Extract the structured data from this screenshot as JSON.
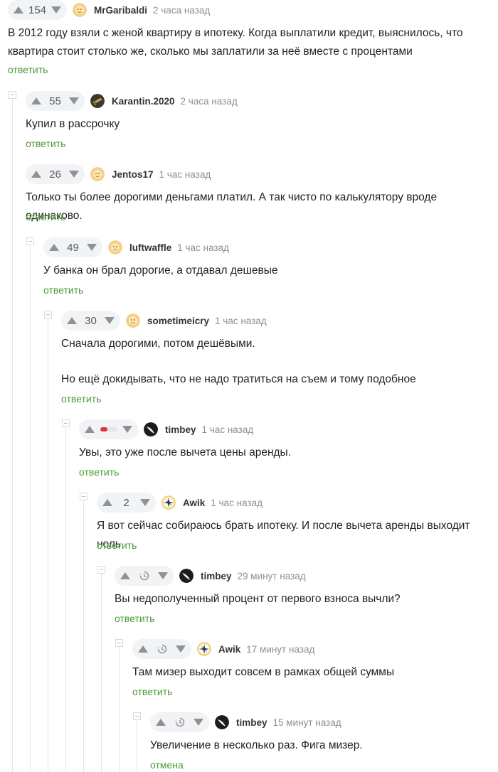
{
  "ui": {
    "reply_label": "ответить",
    "cancel_label": "отмена",
    "colors": {
      "accent_green": "#4a9b32",
      "minus_red": "#e0323a"
    }
  },
  "comments": [
    {
      "rating": "154",
      "author": "MrGaribaldi",
      "time": "2 часа назад",
      "text": "В 2012 году взяли с женой квартиру в ипотеку. Когда выплатили кредит, выяснилось, что квартира стоит столько же, сколько мы заплатили за неё вместе с процентами",
      "avatar": "default-avatar-icon"
    },
    {
      "rating": "55",
      "author": "Karantin.2020",
      "time": "2 часа назад",
      "text": "Купил в рассрочку",
      "avatar": "gun-avatar-icon"
    },
    {
      "rating": "26",
      "author": "Jentos17",
      "time": "1 час назад",
      "text": "Только ты более дорогими деньгами платил. А так чисто по калькулятору вроде одинаково.",
      "avatar": "default-avatar-icon"
    },
    {
      "rating": "49",
      "author": "luftwaffle",
      "time": "1 час назад",
      "text": "У банка он брал дорогие, а отдавал дешевые",
      "avatar": "default-avatar-icon"
    },
    {
      "rating": "30",
      "author": "sometimeicry",
      "time": "1 час назад",
      "text": "Сначала дорогими, потом дешёвыми.",
      "text2": "Но ещё докидывать, что не надо тратиться на съем и тому подобное",
      "avatar": "default-avatar-icon"
    },
    {
      "rating_state": "minus",
      "minus_fraction": 0.45,
      "author": "timbey",
      "time": "1 час назад",
      "text": "Увы, это уже после вычета цены аренды.",
      "avatar": "bw-avatar-icon"
    },
    {
      "rating": "2",
      "author": "Awik",
      "time": "1 час назад",
      "text": "Я вот сейчас собираюсь брать ипотеку. И после вычета аренды выходит ноль",
      "avatar": "compass-avatar-icon"
    },
    {
      "rating_state": "pending",
      "author": "timbey",
      "time": "29 минут назад",
      "text": "Вы недополученный процент от первого взноса вычли?",
      "avatar": "bw-avatar-icon"
    },
    {
      "rating_state": "pending",
      "author": "Awik",
      "time": "17 минут назад",
      "text": "Там мизер выходит совсем в рамках общей суммы",
      "avatar": "compass-avatar-icon"
    },
    {
      "rating_state": "pending",
      "author": "timbey",
      "time": "15 минут назад",
      "text": "Увеличение в несколько раз. Фига мизер.",
      "avatar": "bw-avatar-icon"
    }
  ]
}
